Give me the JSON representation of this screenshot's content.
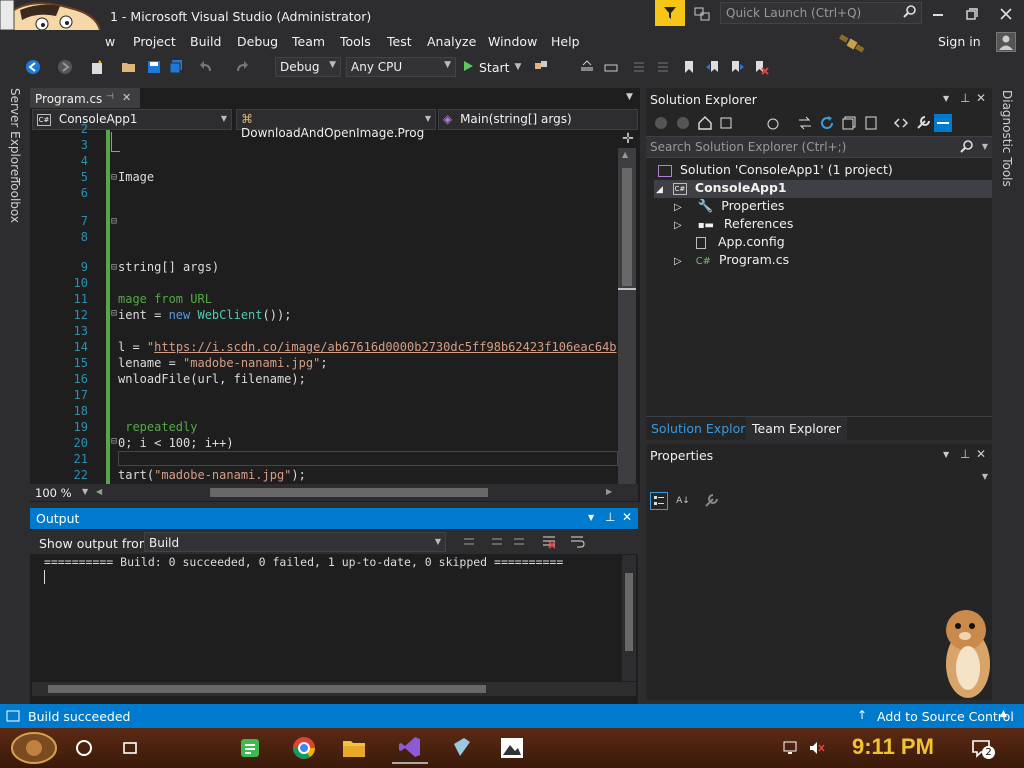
{
  "title_bar": {
    "title": "1 - Microsoft Visual Studio  (Administrator)",
    "quick_launch_placeholder": "Quick Launch (Ctrl+Q)"
  },
  "menu": {
    "items": [
      "w",
      "Project",
      "Build",
      "Debug",
      "Team",
      "Tools",
      "Test",
      "Analyze",
      "Window",
      "Help"
    ],
    "sign_in": "Sign in"
  },
  "toolbar": {
    "config": "Debug",
    "platform": "Any CPU",
    "start_label": "Start"
  },
  "side_tabs": {
    "left": [
      "Server Explorer",
      "Toolbox"
    ],
    "right": "Diagnostic Tools"
  },
  "editor": {
    "tab_label": "Program.cs",
    "nav_project": "ConsoleApp1",
    "nav_class": "DownloadAndOpenImage.Prog",
    "nav_member": "Main(string[] args)",
    "zoom": "100 %",
    "line_numbers": [
      "2",
      "3",
      "4",
      "5",
      "6",
      "7",
      "8",
      "9",
      "10",
      "11",
      "12",
      "13",
      "14",
      "15",
      "16",
      "17",
      "18",
      "19",
      "20",
      "21",
      "22"
    ],
    "lines": [
      {
        "n": "5",
        "text": "Image",
        "color": "#dcdcdc"
      },
      {
        "n": "9",
        "text": "string[] args)",
        "color": "#dcdcdc"
      },
      {
        "n": "11",
        "text": "mage from URL",
        "color": "#57a64a"
      },
      {
        "n": "12a",
        "text": "ient = ",
        "color": "#dcdcdc"
      },
      {
        "n": "12b",
        "text": "new ",
        "color": "#569cd6"
      },
      {
        "n": "12c",
        "text": "WebClient",
        "color": "#4ec9b0"
      },
      {
        "n": "12d",
        "text": "());",
        "color": "#dcdcdc"
      },
      {
        "n": "14a",
        "text": "l = ",
        "color": "#dcdcdc"
      },
      {
        "n": "14b",
        "text": "\"",
        "color": "#d69d85"
      },
      {
        "n": "14c",
        "text": "https://i.scdn.co/image/ab67616d0000b2730dc5ff98b62423f106eac64b",
        "color": "#d69d85"
      },
      {
        "n": "14d",
        "text": "\";",
        "color": "#d69d85"
      },
      {
        "n": "15a",
        "text": "lename = ",
        "color": "#dcdcdc"
      },
      {
        "n": "15b",
        "text": "\"madobe-nanami.jpg\"",
        "color": "#d69d85"
      },
      {
        "n": "15c",
        "text": ";",
        "color": "#dcdcdc"
      },
      {
        "n": "16",
        "text": "wnloadFile(url, filename);",
        "color": "#dcdcdc"
      },
      {
        "n": "19",
        "text": " repeatedly",
        "color": "#57a64a"
      },
      {
        "n": "20",
        "text": "0; i < 100; i++)",
        "color": "#dcdcdc"
      },
      {
        "n": "22a",
        "text": "tart(",
        "color": "#dcdcdc"
      },
      {
        "n": "22b",
        "text": "\"madobe-nanami.jpg\"",
        "color": "#d69d85"
      },
      {
        "n": "22c",
        "text": ");",
        "color": "#dcdcdc"
      }
    ]
  },
  "output": {
    "title": "Output",
    "show_from_label": "Show output from:",
    "source": "Build",
    "text": "========== Build: 0 succeeded, 0 failed, 1 up-to-date, 0 skipped =========="
  },
  "solution_explorer": {
    "title": "Solution Explorer",
    "search_placeholder": "Search Solution Explorer (Ctrl+;)",
    "solution_label": "Solution 'ConsoleApp1' (1 project)",
    "project_label": "ConsoleApp1",
    "items": [
      "Properties",
      "References",
      "App.config",
      "Program.cs"
    ],
    "tabs": [
      "Solution Explorer",
      "Team Explorer"
    ]
  },
  "properties": {
    "title": "Properties"
  },
  "status": {
    "left": "Build succeeded",
    "right": "Add to Source Control"
  },
  "taskbar": {
    "time": "9:11 PM",
    "notif_count": "2"
  },
  "colors": {
    "accent": "#007acc",
    "background": "#2d2d30",
    "editor_bg": "#1e1e1e"
  }
}
